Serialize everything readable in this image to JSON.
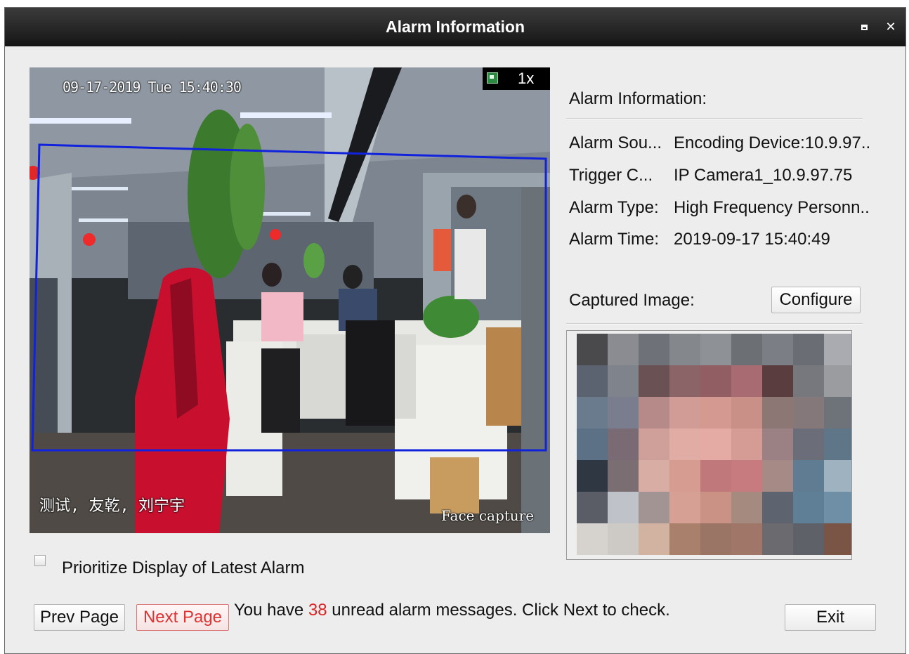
{
  "window": {
    "title": "Alarm Information",
    "maximize_icon": "maximize-icon",
    "close_icon": "close-icon",
    "close_glyph": "✕"
  },
  "video": {
    "timestamp": "09-17-2019 Tue 15:40:30",
    "zoom": "1x",
    "zoom_icon": "snapshot-icon",
    "overlay_name": "测试, 友乾, 刘宁宇",
    "overlay_capture": "Face capture"
  },
  "alarm_info": {
    "heading": "Alarm Information:",
    "rows": [
      {
        "label": "Alarm Sou...",
        "value": "Encoding Device:10.9.97.."
      },
      {
        "label": "Trigger C...",
        "value": "IP Camera1_10.9.97.75"
      },
      {
        "label": "Alarm Type:",
        "value": "High Frequency Personn.."
      },
      {
        "label": "Alarm Time:",
        "value": "2019-09-17 15:40:49"
      }
    ]
  },
  "captured": {
    "label": "Captured Image:",
    "configure_label": "Configure",
    "pixels": [
      [
        "#4a4a4d",
        "#8a8c92",
        "#6e7278",
        "#84878c",
        "#8e9196",
        "#6c7075",
        "#7b7f85",
        "#6a6e74",
        "#a9abb0"
      ],
      [
        "#5b6370",
        "#7f838c",
        "#6a5154",
        "#8a6466",
        "#915e63",
        "#a86b72",
        "#5a3d3f",
        "#76787e",
        "#9a9ca0"
      ],
      [
        "#6b7b8e",
        "#7a7d8e",
        "#b58a88",
        "#d19c95",
        "#d49a91",
        "#c99088",
        "#8d7775",
        "#85787a",
        "#6d7379"
      ],
      [
        "#5c7185",
        "#7a6a73",
        "#cf9f9a",
        "#e0aca4",
        "#e3aba3",
        "#d59c96",
        "#9b8183",
        "#6b6e78",
        "#5f7689"
      ],
      [
        "#2f3743",
        "#7b6e72",
        "#d7ada4",
        "#d69b91",
        "#c0787a",
        "#c77b7f",
        "#a58a85",
        "#5f7c92",
        "#9fb2bf"
      ],
      [
        "#5a5d66",
        "#c0c2c9",
        "#a39494",
        "#d6a194",
        "#c99284",
        "#a58a80",
        "#5d6470",
        "#5f7f97",
        "#6e8fa5"
      ],
      [
        "#d6d3cf",
        "#cdc9c4",
        "#d2b2a0",
        "#a9806c",
        "#9a7465",
        "#a07668",
        "#6a6a6f",
        "#5e6268",
        "#7a5546"
      ]
    ]
  },
  "options": {
    "prioritize_label": "Prioritize Display of Latest Alarm",
    "prioritize_checked": false
  },
  "footer": {
    "prev_label": "Prev Page",
    "next_label": "Next Page",
    "status_prefix": "You have ",
    "unread_count": "38",
    "status_suffix": " unread alarm messages. Click Next to check.",
    "exit_label": "Exit"
  }
}
